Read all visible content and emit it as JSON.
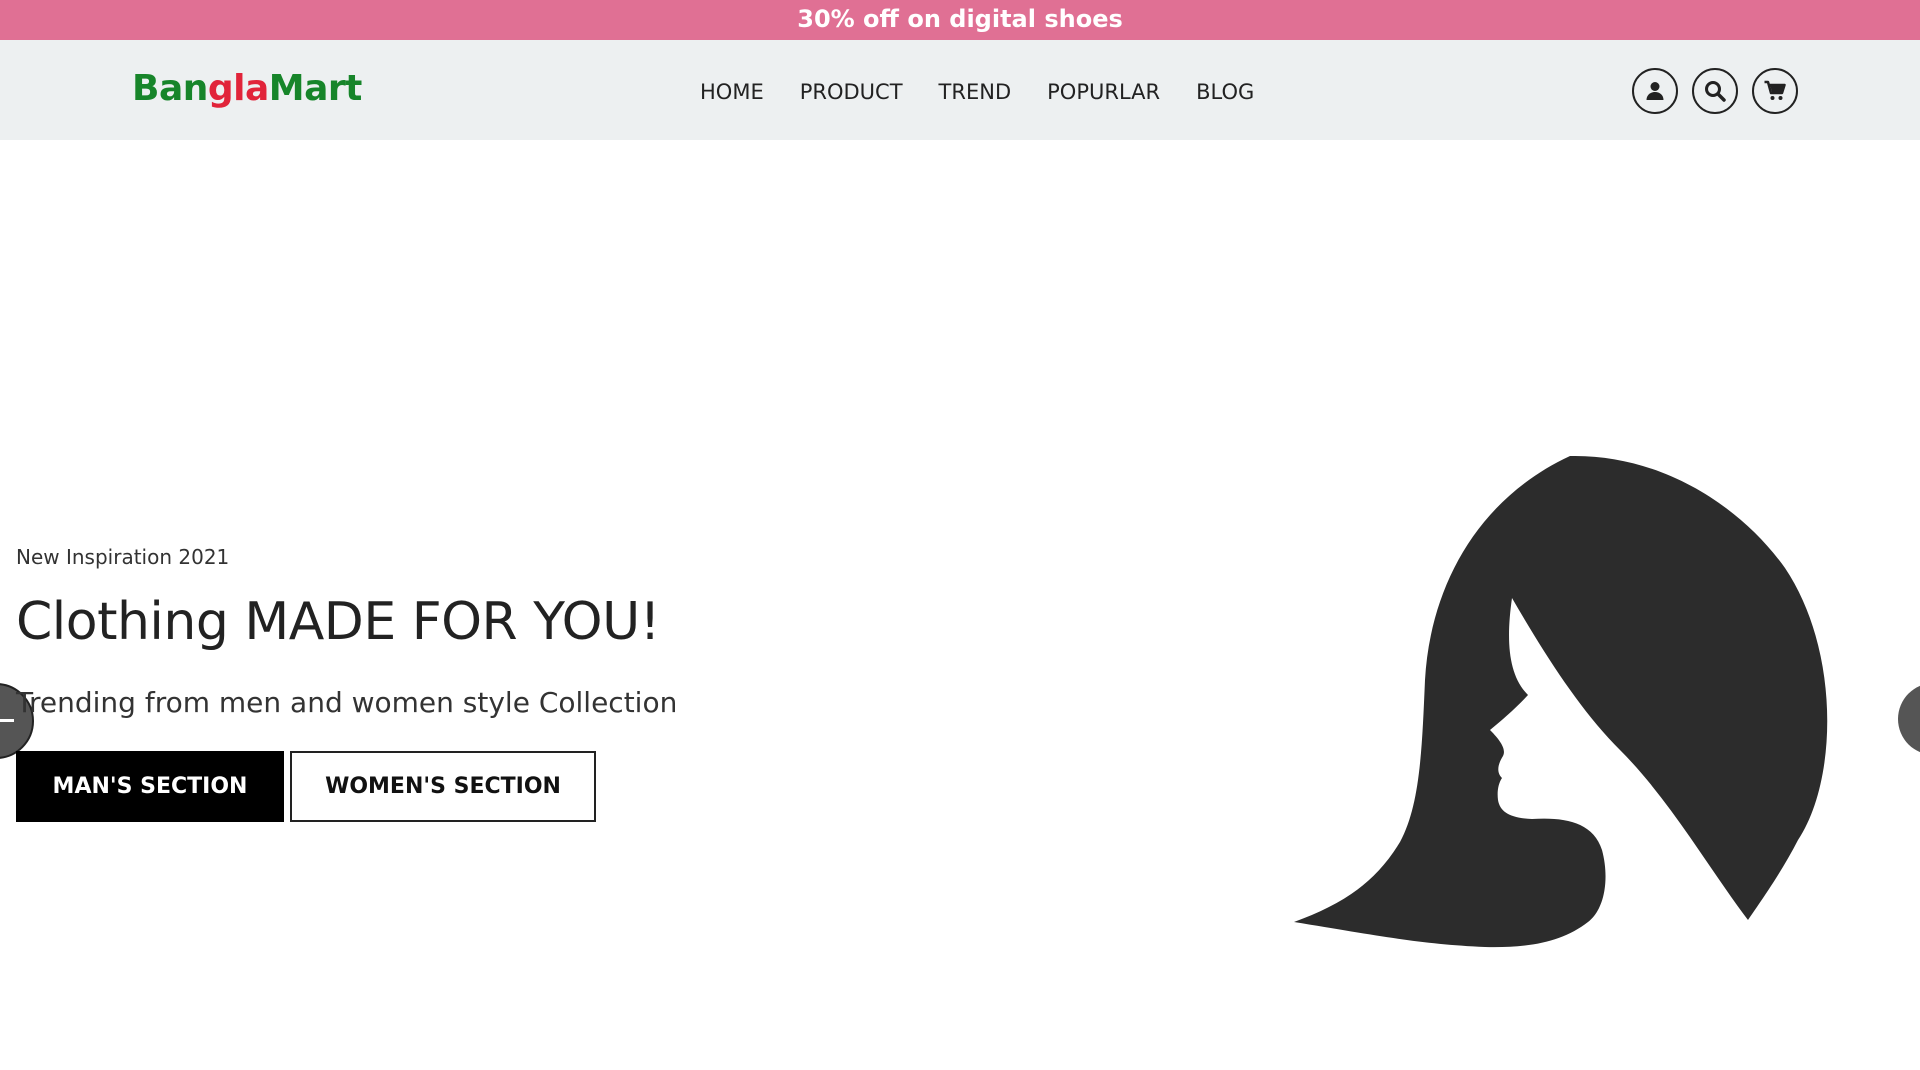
{
  "promo": {
    "text": "30% off on digital shoes"
  },
  "header": {
    "logo_part1": "Ban",
    "logo_part2": "gla",
    "logo_part3": "Mart",
    "nav": [
      "HOME",
      "PRODUCT",
      "TREND",
      "POPURLAR",
      "BLOG"
    ],
    "icons": [
      "user-icon",
      "search-icon",
      "cart-icon"
    ]
  },
  "hero": {
    "subtitle": "New Inspiration 2021",
    "title": "Clothing MADE FOR YOU!",
    "description": "Trending from men and women style Collection",
    "btn_man": "MAN'S SECTION",
    "btn_women": "WOMEN'S SECTION",
    "illustration": "woman-silhouette"
  },
  "colors": {
    "promo_bg": "#e07094",
    "logo_green": "#17852a",
    "logo_red": "#e1243a",
    "header_bg": "#edf0f1"
  }
}
